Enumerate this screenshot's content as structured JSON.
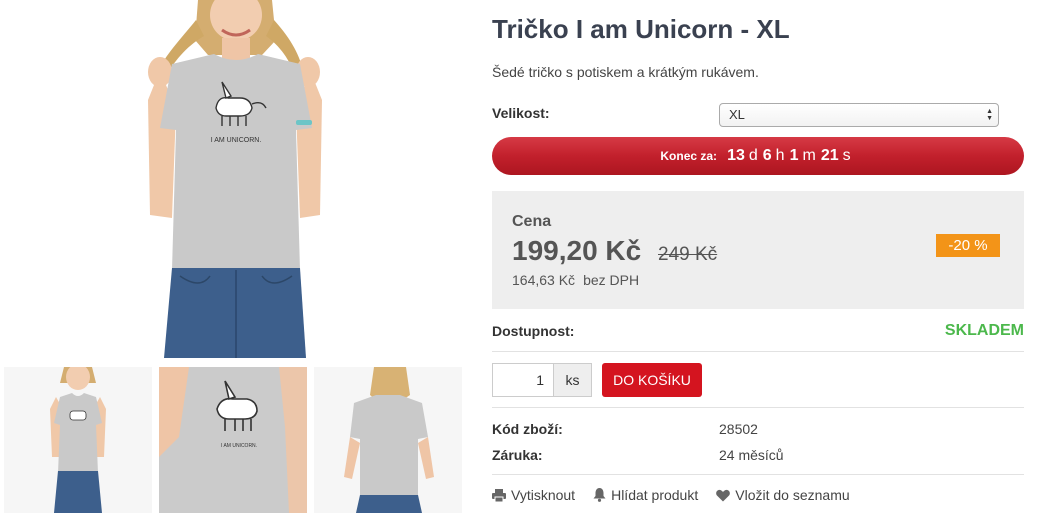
{
  "product": {
    "title": "Tričko I am Unicorn - XL",
    "description": "Šedé tričko s potiskem a krátkým rukávem.",
    "shirt_print_text": "I AM UNICORN."
  },
  "variant": {
    "label": "Velikost:",
    "selected": "XL"
  },
  "countdown": {
    "label": "Konec za:",
    "days": "13",
    "days_unit": "d",
    "hours": "6",
    "hours_unit": "h",
    "minutes": "1",
    "minutes_unit": "m",
    "seconds": "21",
    "seconds_unit": "s"
  },
  "pricing": {
    "label": "Cena",
    "price": "199,20 Kč",
    "old_price": "249 Kč",
    "price_without_vat": "164,63 Kč",
    "vat_label": "bez DPH",
    "discount": "-20 %"
  },
  "availability": {
    "label": "Dostupnost:",
    "value": "SKLADEM"
  },
  "cart": {
    "quantity": "1",
    "unit": "ks",
    "button_label": "DO KOŠÍKU"
  },
  "details": [
    {
      "label": "Kód zboží:",
      "value": "28502"
    },
    {
      "label": "Záruka:",
      "value": "24 měsíců"
    }
  ],
  "actions": [
    {
      "label": "Vytisknout",
      "icon": "printer-icon"
    },
    {
      "label": "Hlídat produkt",
      "icon": "bell-icon"
    },
    {
      "label": "Vložit do seznamu",
      "icon": "heart-icon"
    }
  ],
  "colors": {
    "countdown_red": "#c2202c",
    "cart_red": "#d4141f",
    "discount_orange": "#f39418",
    "stock_green": "#4cb84c",
    "shirt_grey": "#c9c9c9",
    "jeans_blue": "#3d5f8c"
  }
}
